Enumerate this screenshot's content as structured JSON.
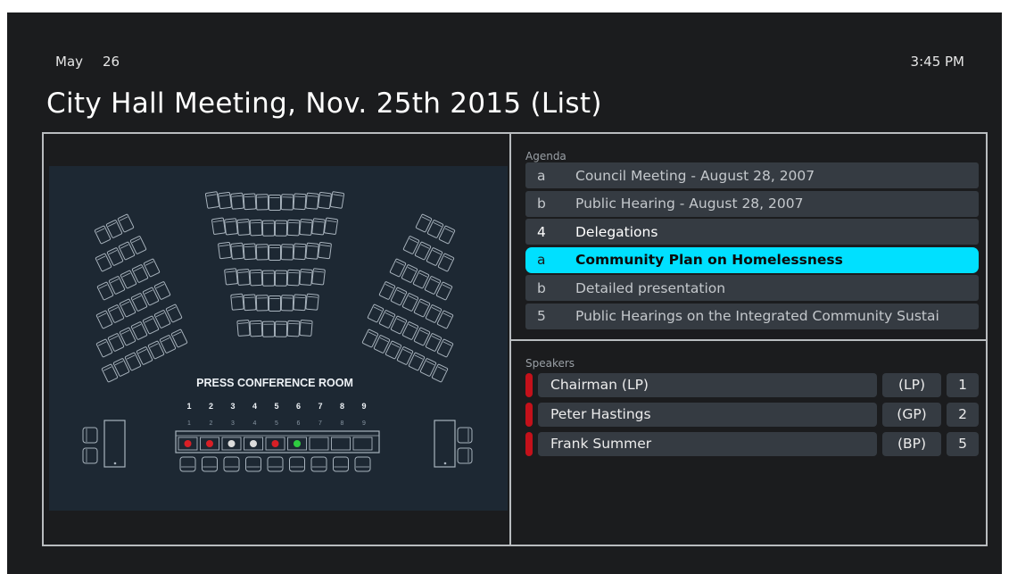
{
  "header": {
    "month": "May",
    "day": "26",
    "time": "3:45 PM",
    "title": "City Hall Meeting, Nov. 25th 2015 (List)"
  },
  "floorplan": {
    "room_label": "PRESS CONFERENCE ROOM",
    "seat_numbers": [
      "1",
      "2",
      "3",
      "4",
      "5",
      "6",
      "7",
      "8",
      "9"
    ],
    "seat_status": [
      "red",
      "red",
      "white",
      "white",
      "red",
      "green",
      "none",
      "none",
      "none"
    ],
    "colors": {
      "red": "#d81f26",
      "white": "#dcdcdc",
      "green": "#2ecc40",
      "line": "#a8b3bd",
      "background": "#1d2833"
    }
  },
  "agenda": {
    "label": "Agenda",
    "items": [
      {
        "num": "a",
        "text": "Council Meeting - August 28, 2007",
        "style": "normal"
      },
      {
        "num": "b",
        "text": "Public Hearing - August 28, 2007",
        "style": "normal"
      },
      {
        "num": "4",
        "text": "Delegations",
        "style": "bright"
      },
      {
        "num": "a",
        "text": "Community Plan on Homelessness",
        "style": "selected"
      },
      {
        "num": "b",
        "text": "Detailed presentation",
        "style": "normal"
      },
      {
        "num": "5",
        "text": "Public Hearings on the Integrated Community Sustai",
        "style": "normal"
      }
    ],
    "accent": "#00e0ff"
  },
  "speakers": {
    "label": "Speakers",
    "items": [
      {
        "name": "Chairman  (LP)",
        "party": "(LP)",
        "seat": "1"
      },
      {
        "name": "Peter Hastings",
        "party": "(GP)",
        "seat": "2"
      },
      {
        "name": "Frank Summer",
        "party": "(BP)",
        "seat": "5"
      }
    ],
    "indicator_color": "#c4111a"
  }
}
